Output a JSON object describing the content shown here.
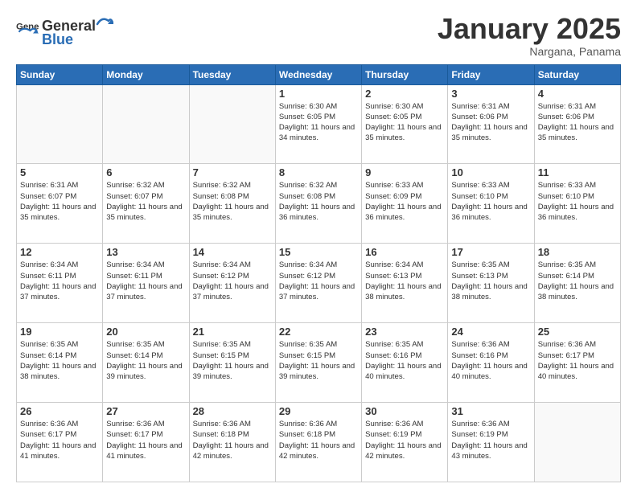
{
  "header": {
    "logo_general": "General",
    "logo_blue": "Blue",
    "month_title": "January 2025",
    "location": "Nargana, Panama"
  },
  "weekdays": [
    "Sunday",
    "Monday",
    "Tuesday",
    "Wednesday",
    "Thursday",
    "Friday",
    "Saturday"
  ],
  "weeks": [
    [
      {
        "day": "",
        "sunrise": "",
        "sunset": "",
        "daylight": ""
      },
      {
        "day": "",
        "sunrise": "",
        "sunset": "",
        "daylight": ""
      },
      {
        "day": "",
        "sunrise": "",
        "sunset": "",
        "daylight": ""
      },
      {
        "day": "1",
        "sunrise": "Sunrise: 6:30 AM",
        "sunset": "Sunset: 6:05 PM",
        "daylight": "Daylight: 11 hours and 34 minutes."
      },
      {
        "day": "2",
        "sunrise": "Sunrise: 6:30 AM",
        "sunset": "Sunset: 6:05 PM",
        "daylight": "Daylight: 11 hours and 35 minutes."
      },
      {
        "day": "3",
        "sunrise": "Sunrise: 6:31 AM",
        "sunset": "Sunset: 6:06 PM",
        "daylight": "Daylight: 11 hours and 35 minutes."
      },
      {
        "day": "4",
        "sunrise": "Sunrise: 6:31 AM",
        "sunset": "Sunset: 6:06 PM",
        "daylight": "Daylight: 11 hours and 35 minutes."
      }
    ],
    [
      {
        "day": "5",
        "sunrise": "Sunrise: 6:31 AM",
        "sunset": "Sunset: 6:07 PM",
        "daylight": "Daylight: 11 hours and 35 minutes."
      },
      {
        "day": "6",
        "sunrise": "Sunrise: 6:32 AM",
        "sunset": "Sunset: 6:07 PM",
        "daylight": "Daylight: 11 hours and 35 minutes."
      },
      {
        "day": "7",
        "sunrise": "Sunrise: 6:32 AM",
        "sunset": "Sunset: 6:08 PM",
        "daylight": "Daylight: 11 hours and 35 minutes."
      },
      {
        "day": "8",
        "sunrise": "Sunrise: 6:32 AM",
        "sunset": "Sunset: 6:08 PM",
        "daylight": "Daylight: 11 hours and 36 minutes."
      },
      {
        "day": "9",
        "sunrise": "Sunrise: 6:33 AM",
        "sunset": "Sunset: 6:09 PM",
        "daylight": "Daylight: 11 hours and 36 minutes."
      },
      {
        "day": "10",
        "sunrise": "Sunrise: 6:33 AM",
        "sunset": "Sunset: 6:10 PM",
        "daylight": "Daylight: 11 hours and 36 minutes."
      },
      {
        "day": "11",
        "sunrise": "Sunrise: 6:33 AM",
        "sunset": "Sunset: 6:10 PM",
        "daylight": "Daylight: 11 hours and 36 minutes."
      }
    ],
    [
      {
        "day": "12",
        "sunrise": "Sunrise: 6:34 AM",
        "sunset": "Sunset: 6:11 PM",
        "daylight": "Daylight: 11 hours and 37 minutes."
      },
      {
        "day": "13",
        "sunrise": "Sunrise: 6:34 AM",
        "sunset": "Sunset: 6:11 PM",
        "daylight": "Daylight: 11 hours and 37 minutes."
      },
      {
        "day": "14",
        "sunrise": "Sunrise: 6:34 AM",
        "sunset": "Sunset: 6:12 PM",
        "daylight": "Daylight: 11 hours and 37 minutes."
      },
      {
        "day": "15",
        "sunrise": "Sunrise: 6:34 AM",
        "sunset": "Sunset: 6:12 PM",
        "daylight": "Daylight: 11 hours and 37 minutes."
      },
      {
        "day": "16",
        "sunrise": "Sunrise: 6:34 AM",
        "sunset": "Sunset: 6:13 PM",
        "daylight": "Daylight: 11 hours and 38 minutes."
      },
      {
        "day": "17",
        "sunrise": "Sunrise: 6:35 AM",
        "sunset": "Sunset: 6:13 PM",
        "daylight": "Daylight: 11 hours and 38 minutes."
      },
      {
        "day": "18",
        "sunrise": "Sunrise: 6:35 AM",
        "sunset": "Sunset: 6:14 PM",
        "daylight": "Daylight: 11 hours and 38 minutes."
      }
    ],
    [
      {
        "day": "19",
        "sunrise": "Sunrise: 6:35 AM",
        "sunset": "Sunset: 6:14 PM",
        "daylight": "Daylight: 11 hours and 38 minutes."
      },
      {
        "day": "20",
        "sunrise": "Sunrise: 6:35 AM",
        "sunset": "Sunset: 6:14 PM",
        "daylight": "Daylight: 11 hours and 39 minutes."
      },
      {
        "day": "21",
        "sunrise": "Sunrise: 6:35 AM",
        "sunset": "Sunset: 6:15 PM",
        "daylight": "Daylight: 11 hours and 39 minutes."
      },
      {
        "day": "22",
        "sunrise": "Sunrise: 6:35 AM",
        "sunset": "Sunset: 6:15 PM",
        "daylight": "Daylight: 11 hours and 39 minutes."
      },
      {
        "day": "23",
        "sunrise": "Sunrise: 6:35 AM",
        "sunset": "Sunset: 6:16 PM",
        "daylight": "Daylight: 11 hours and 40 minutes."
      },
      {
        "day": "24",
        "sunrise": "Sunrise: 6:36 AM",
        "sunset": "Sunset: 6:16 PM",
        "daylight": "Daylight: 11 hours and 40 minutes."
      },
      {
        "day": "25",
        "sunrise": "Sunrise: 6:36 AM",
        "sunset": "Sunset: 6:17 PM",
        "daylight": "Daylight: 11 hours and 40 minutes."
      }
    ],
    [
      {
        "day": "26",
        "sunrise": "Sunrise: 6:36 AM",
        "sunset": "Sunset: 6:17 PM",
        "daylight": "Daylight: 11 hours and 41 minutes."
      },
      {
        "day": "27",
        "sunrise": "Sunrise: 6:36 AM",
        "sunset": "Sunset: 6:17 PM",
        "daylight": "Daylight: 11 hours and 41 minutes."
      },
      {
        "day": "28",
        "sunrise": "Sunrise: 6:36 AM",
        "sunset": "Sunset: 6:18 PM",
        "daylight": "Daylight: 11 hours and 42 minutes."
      },
      {
        "day": "29",
        "sunrise": "Sunrise: 6:36 AM",
        "sunset": "Sunset: 6:18 PM",
        "daylight": "Daylight: 11 hours and 42 minutes."
      },
      {
        "day": "30",
        "sunrise": "Sunrise: 6:36 AM",
        "sunset": "Sunset: 6:19 PM",
        "daylight": "Daylight: 11 hours and 42 minutes."
      },
      {
        "day": "31",
        "sunrise": "Sunrise: 6:36 AM",
        "sunset": "Sunset: 6:19 PM",
        "daylight": "Daylight: 11 hours and 43 minutes."
      },
      {
        "day": "",
        "sunrise": "",
        "sunset": "",
        "daylight": ""
      }
    ]
  ]
}
